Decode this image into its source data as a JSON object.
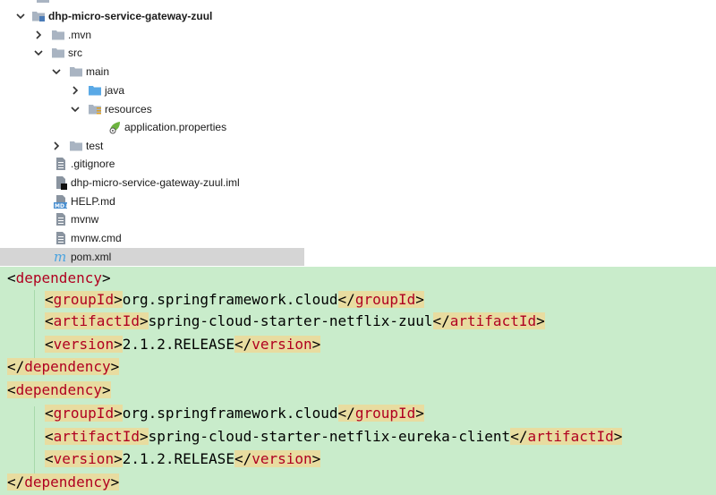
{
  "tree": {
    "project": "dhp-micro-service-gateway-zuul",
    "mvn": ".mvn",
    "src": "src",
    "main": "main",
    "java": "java",
    "resources": "resources",
    "app_props": "application.properties",
    "test": "test",
    "gitignore": ".gitignore",
    "iml": "dhp-micro-service-gateway-zuul.iml",
    "help": "HELP.md",
    "mvnw": "mvnw",
    "mvnw_cmd": "mvnw.cmd",
    "pom": "pom.xml"
  },
  "code": {
    "dep": "dependency",
    "group_tag": "groupId",
    "artifact_tag": "artifactId",
    "version_tag": "version",
    "dep1_group": "org.springframework.cloud",
    "dep1_artifact": "spring-cloud-starter-netflix-zuul",
    "dep1_version": "2.1.2.RELEASE",
    "dep2_group": "org.springframework.cloud",
    "dep2_artifact": "spring-cloud-starter-netflix-eureka-client",
    "dep2_version": "2.1.2.RELEASE"
  },
  "colors": {
    "code_bg": "#c9eccb",
    "tag_name": "#b00020",
    "selection": "#d5d5d5",
    "folder": "#a9b4c2",
    "source_folder": "#5aa9e6"
  }
}
